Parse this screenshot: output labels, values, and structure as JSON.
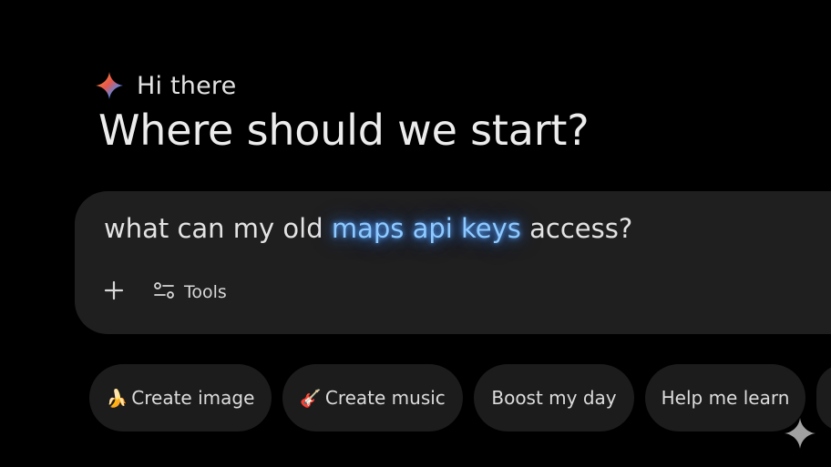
{
  "greeting": {
    "hi": "Hi there",
    "headline": "Where should we start?"
  },
  "prompt": {
    "before": "what can my old ",
    "highlight": "maps api keys",
    "after": " access?"
  },
  "toolbar": {
    "add_icon": "plus-icon",
    "tools_icon": "sliders-icon",
    "tools_label": "Tools"
  },
  "chips": [
    {
      "emoji": "🍌",
      "label": "Create image"
    },
    {
      "emoji": "🎸",
      "label": "Create music"
    },
    {
      "emoji": "",
      "label": "Boost my day"
    },
    {
      "emoji": "",
      "label": "Help me learn"
    }
  ],
  "colors": {
    "background": "#000000",
    "prompt_box": "#1f1f1f",
    "chip": "#1c1c1c",
    "highlight": "#8ec9ff"
  }
}
